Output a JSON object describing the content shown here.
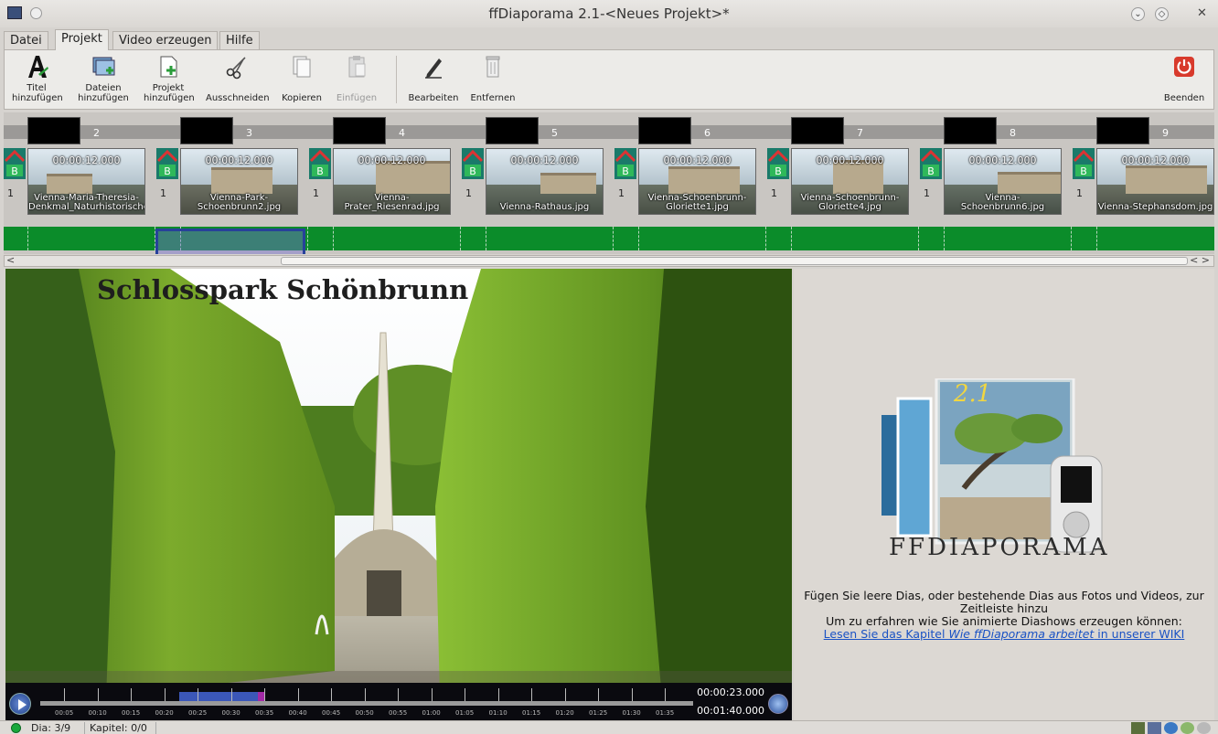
{
  "window": {
    "title": "ffDiaporama 2.1-<Neues Projekt>*"
  },
  "menu": {
    "tabs": [
      "Datei",
      "Projekt",
      "Video erzeugen",
      "Hilfe"
    ],
    "active": "Projekt"
  },
  "toolbar": {
    "add_title": [
      "Titel",
      "hinzufügen"
    ],
    "add_files": [
      "Dateien",
      "hinzufügen"
    ],
    "add_project": [
      "Projekt",
      "hinzufügen"
    ],
    "cut": "Ausschneiden",
    "copy": "Kopieren",
    "paste": "Einfügen",
    "edit": "Bearbeiten",
    "remove": "Entfernen",
    "quit": "Beenden"
  },
  "timeline": {
    "selected_index": 1,
    "slides": [
      {
        "chapter": "2",
        "duration": "00:00:12.000",
        "name": "Vienna-Maria-Theresia-Denkmal_Naturhistorisches.jpg",
        "transition": "1"
      },
      {
        "chapter": "3",
        "duration": "00:00:12.000",
        "name": "Vienna-Park-Schoenbrunn2.jpg",
        "transition": "1"
      },
      {
        "chapter": "4",
        "duration": "00:00:12.000",
        "name": "Vienna-Prater_Riesenrad.jpg",
        "transition": "1"
      },
      {
        "chapter": "5",
        "duration": "00:00:12.000",
        "name": "Vienna-Rathaus.jpg",
        "transition": "1"
      },
      {
        "chapter": "6",
        "duration": "00:00:12.000",
        "name": "Vienna-Schoenbrunn-Gloriette1.jpg",
        "transition": "1"
      },
      {
        "chapter": "7",
        "duration": "00:00:12.000",
        "name": "Vienna-Schoenbrunn-Gloriette4.jpg",
        "transition": "1"
      },
      {
        "chapter": "8",
        "duration": "00:00:12.000",
        "name": "Vienna-Schoenbrunn6.jpg",
        "transition": "1"
      },
      {
        "chapter": "9",
        "duration": "00:00:12.000",
        "name": "Vienna-Stephansdom.jpg",
        "transition": "1"
      }
    ]
  },
  "preview": {
    "slide_title": "Schlosspark Schönbrunn",
    "current_time": "00:00:23.000",
    "total_time": "00:01:40.000",
    "ruler_labels": [
      "00:05",
      "00:10",
      "00:15",
      "00:20",
      "00:25",
      "00:30",
      "00:35",
      "00:40",
      "00:45",
      "00:50",
      "00:55",
      "01:00",
      "01:05",
      "01:10",
      "01:15",
      "01:20",
      "01:25",
      "01:30",
      "01:35"
    ]
  },
  "info": {
    "logo_text": "FFDIAPORAMA",
    "version": "2.1",
    "line1": "Fügen Sie leere Dias, oder bestehende Dias aus Fotos und Videos, zur",
    "line2": "Zeitleiste hinzu",
    "line3": "Um zu erfahren wie Sie animierte Diashows erzeugen können:",
    "link_prefix": "Lesen Sie das Kapitel ",
    "link_italic": "Wie ffDiaporama arbeitet",
    "link_suffix": " in unserer WIKI"
  },
  "status": {
    "slide": "Dia: 3/9",
    "chapter": "Kapitel: 0/0"
  },
  "colors": {
    "timeline_green": "#0b8c2a",
    "selection": "#27419a",
    "link": "#1a52c4"
  }
}
